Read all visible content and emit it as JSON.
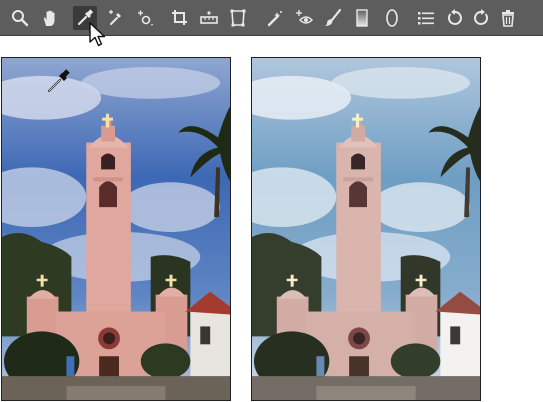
{
  "toolbar": {
    "tools": [
      {
        "id": "zoom",
        "icon": "zoom-icon"
      },
      {
        "id": "hand",
        "icon": "hand-icon"
      },
      {
        "id": "white-balance",
        "icon": "eyedropper-icon",
        "active": true
      },
      {
        "id": "color-sampler",
        "icon": "color-sampler-icon"
      },
      {
        "id": "targeted-adjustment",
        "icon": "targeted-adjustment-icon"
      },
      {
        "id": "crop",
        "icon": "crop-icon"
      },
      {
        "id": "straighten",
        "icon": "straighten-icon"
      },
      {
        "id": "transform",
        "icon": "transform-icon"
      },
      {
        "id": "spot-removal",
        "icon": "spot-removal-icon"
      },
      {
        "id": "red-eye",
        "icon": "red-eye-icon"
      },
      {
        "id": "adjustment-brush",
        "icon": "brush-icon"
      },
      {
        "id": "graduated-filter",
        "icon": "graduated-filter-icon"
      },
      {
        "id": "radial-filter",
        "icon": "radial-filter-icon"
      },
      {
        "id": "preferences",
        "icon": "list-icon"
      },
      {
        "id": "rotate-left",
        "icon": "rotate-ccw-icon"
      },
      {
        "id": "rotate-right",
        "icon": "rotate-cw-icon"
      },
      {
        "id": "delete",
        "icon": "trash-icon"
      }
    ]
  },
  "colors": {
    "toolbar_bg": "#5d5d5d",
    "icon": "#e8e8e8",
    "sky_before": "#3d68b5",
    "sky_after": "#5f9ac8",
    "church": "#e0a79e"
  }
}
